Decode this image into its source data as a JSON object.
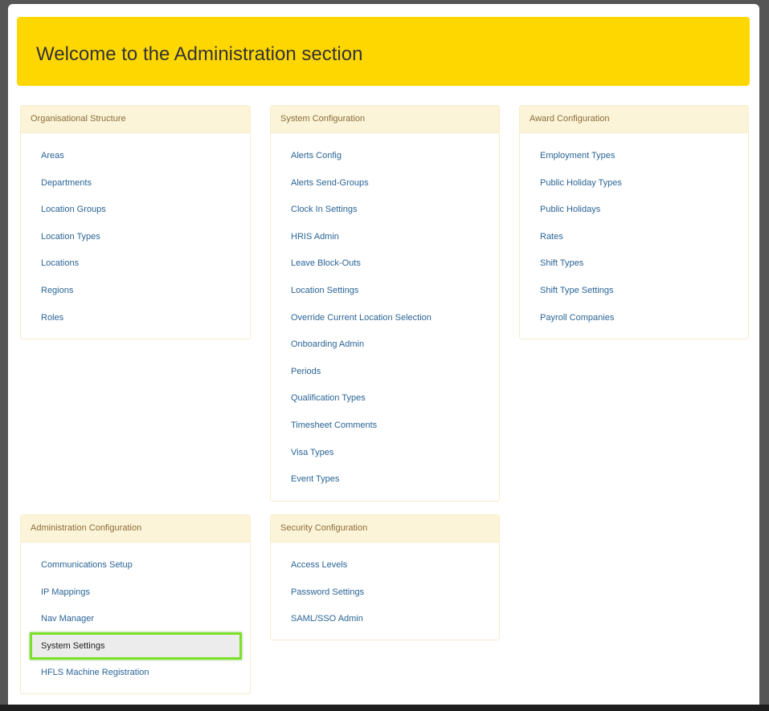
{
  "banner": {
    "title": "Welcome to the Administration section"
  },
  "panels": {
    "organisational": {
      "title": "Organisational Structure",
      "items": [
        "Areas",
        "Departments",
        "Location Groups",
        "Location Types",
        "Locations",
        "Regions",
        "Roles"
      ]
    },
    "system": {
      "title": "System Configuration",
      "items": [
        "Alerts Config",
        "Alerts Send-Groups",
        "Clock In Settings",
        "HRIS Admin",
        "Leave Block-Outs",
        "Location Settings",
        "Override Current Location Selection",
        "Onboarding Admin",
        "Periods",
        "Qualification Types",
        "Timesheet Comments",
        "Visa Types",
        "Event Types"
      ]
    },
    "award": {
      "title": "Award Configuration",
      "items": [
        "Employment Types",
        "Public Holiday Types",
        "Public Holidays",
        "Rates",
        "Shift Types",
        "Shift Type Settings",
        "Payroll Companies"
      ]
    },
    "administration": {
      "title": "Administration Configuration",
      "items": [
        "Communications Setup",
        "IP Mappings",
        "Nav Manager",
        "System Settings",
        "HFLS Machine Registration"
      ],
      "selected": "System Settings"
    },
    "security": {
      "title": "Security Configuration",
      "items": [
        "Access Levels",
        "Password Settings",
        "SAML/SSO Admin"
      ]
    }
  }
}
